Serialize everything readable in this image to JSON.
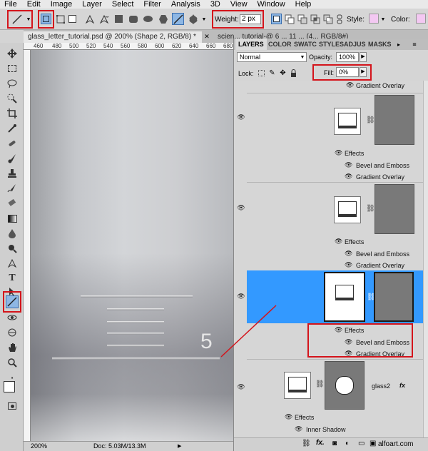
{
  "menu": [
    "File",
    "Edit",
    "Image",
    "Layer",
    "Select",
    "Filter",
    "Analysis",
    "3D",
    "View",
    "Window",
    "Help"
  ],
  "options": {
    "weight_label": "Weight:",
    "weight_value": "2 px",
    "style_label": "Style:",
    "color_label": "Color:"
  },
  "tabs": [
    "glass_letter_tutorial.psd @ 200% (Shape 2, RGB/8) *",
    "scien... tutorial-@ 6 ... 11 ... (4... RGB/8#)"
  ],
  "ruler_labels": [
    "460",
    "480",
    "500",
    "520",
    "540",
    "560",
    "580",
    "600",
    "620",
    "640",
    "660",
    "680"
  ],
  "canvas_number": "5",
  "status": {
    "zoom": "200%",
    "doc": "Doc: 5.03M/13.3M"
  },
  "panel": {
    "tabs": [
      "LAYERS",
      "COLOR",
      "SWATC",
      "STYLES",
      "ADJUS",
      "MASKS"
    ],
    "blend_mode": "Normal",
    "opacity_label": "Opacity:",
    "opacity_value": "100%",
    "lock_label": "Lock:",
    "fill_label": "Fill:",
    "fill_value": "0%",
    "layers": {
      "top_effect": "Gradient Overlay",
      "l1": {
        "effects": "Effects",
        "fx1": "Bevel and Emboss",
        "fx2": "Gradient Overlay"
      },
      "l2": {
        "effects": "Effects",
        "fx1": "Bevel and Emboss",
        "fx2": "Gradient Overlay"
      },
      "l3": {
        "effects": "Effects",
        "fx1": "Bevel and Emboss",
        "fx2": "Gradient Overlay"
      },
      "l4": {
        "name": "glass2",
        "fx": "fx",
        "effects": "Effects",
        "fx1": "Inner Shadow"
      }
    },
    "watermark": "alfoart.com"
  },
  "colors": {
    "highlight": "#3399ff",
    "annotation": "#d4141b"
  }
}
